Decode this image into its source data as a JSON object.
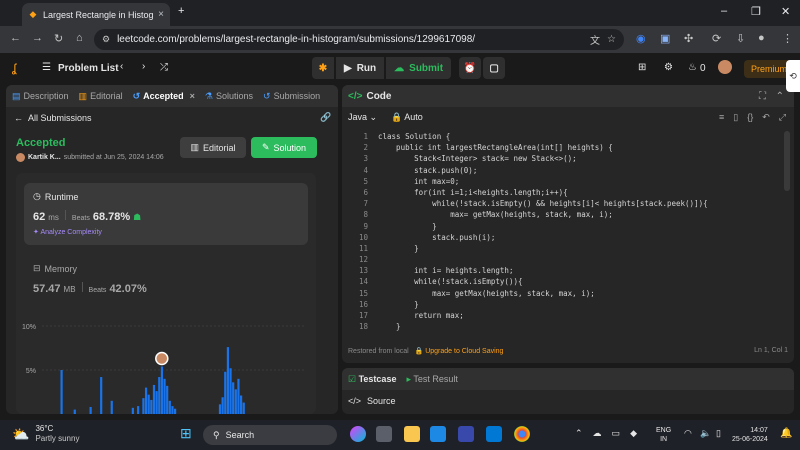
{
  "browser": {
    "tab_title": "Largest Rectangle in Histogram",
    "url": "leetcode.com/problems/largest-rectangle-in-histogram/submissions/1299617098/"
  },
  "nav": {
    "problem_list": "Problem List",
    "run": "Run",
    "submit": "Submit",
    "coins": "0",
    "premium": "Premium"
  },
  "left_tabs": [
    {
      "label": "Description",
      "icon": "doc-icon"
    },
    {
      "label": "Editorial",
      "icon": "book-icon"
    },
    {
      "label": "Accepted",
      "icon": "history-icon"
    },
    {
      "label": "Solutions",
      "icon": "flask-icon"
    },
    {
      "label": "Submission",
      "icon": "history-icon"
    }
  ],
  "submission": {
    "back_label": "All Submissions",
    "status": "Accepted",
    "user": "Kartik K...",
    "submitted_at": "submitted at Jun 25, 2024 14:06",
    "editorial_btn": "Editorial",
    "solution_btn": "Solution"
  },
  "runtime": {
    "title": "Runtime",
    "value": "62",
    "unit": "ms",
    "beats_label": "Beats",
    "beats": "68.78%",
    "analyze": "Analyze Complexity"
  },
  "memory": {
    "title": "Memory",
    "value": "57.47",
    "unit": "MB",
    "beats_label": "Beats",
    "beats": "42.07%"
  },
  "chart_data": {
    "type": "bar",
    "y_ticks": [
      "10%",
      "5%"
    ],
    "ylim": [
      0,
      10
    ],
    "bars": [
      {
        "pos": 0.07,
        "value": 5.0
      },
      {
        "pos": 0.12,
        "value": 0.5
      },
      {
        "pos": 0.18,
        "value": 0.8
      },
      {
        "pos": 0.22,
        "value": 4.2
      },
      {
        "pos": 0.26,
        "value": 1.5
      },
      {
        "pos": 0.34,
        "value": 0.7
      },
      {
        "pos": 0.36,
        "value": 0.9
      },
      {
        "pos": 0.38,
        "value": 1.8
      },
      {
        "pos": 0.39,
        "value": 3.0
      },
      {
        "pos": 0.4,
        "value": 2.2
      },
      {
        "pos": 0.41,
        "value": 1.6
      },
      {
        "pos": 0.42,
        "value": 3.3
      },
      {
        "pos": 0.43,
        "value": 2.6
      },
      {
        "pos": 0.44,
        "value": 4.2
      },
      {
        "pos": 0.45,
        "value": 5.4
      },
      {
        "pos": 0.46,
        "value": 4.0
      },
      {
        "pos": 0.47,
        "value": 3.2
      },
      {
        "pos": 0.48,
        "value": 1.5
      },
      {
        "pos": 0.49,
        "value": 0.9
      },
      {
        "pos": 0.5,
        "value": 0.6
      },
      {
        "pos": 0.67,
        "value": 1.1
      },
      {
        "pos": 0.68,
        "value": 1.9
      },
      {
        "pos": 0.69,
        "value": 4.8
      },
      {
        "pos": 0.7,
        "value": 7.6
      },
      {
        "pos": 0.71,
        "value": 5.2
      },
      {
        "pos": 0.72,
        "value": 3.6
      },
      {
        "pos": 0.73,
        "value": 2.8
      },
      {
        "pos": 0.74,
        "value": 4.0
      },
      {
        "pos": 0.75,
        "value": 2.1
      },
      {
        "pos": 0.76,
        "value": 1.3
      }
    ],
    "highlight_pos": 0.45
  },
  "code_panel": {
    "title": "Code",
    "language": "Java",
    "mode": "Auto",
    "line_numbers": [
      "1",
      "2",
      "3",
      "4",
      "5",
      "6",
      "7",
      "8",
      "9",
      "10",
      "11",
      "12",
      "13",
      "14",
      "15",
      "16",
      "17",
      "18"
    ],
    "lines": [
      "class Solution {",
      "    public int largestRectangleArea(int[] heights) {",
      "        Stack<Integer> stack= new Stack<>();",
      "        stack.push(0);",
      "        int max=0;",
      "        for(int i=1;i<heights.length;i++){",
      "            while(!stack.isEmpty() && heights[i]< heights[stack.peek()]){",
      "                max= getMax(heights, stack, max, i);",
      "            }",
      "            stack.push(i);",
      "        }",
      "",
      "        int i= heights.length;",
      "        while(!stack.isEmpty()){",
      "            max= getMax(heights, stack, max, i);",
      "        }",
      "        return max;",
      "    }"
    ],
    "restored": "Restored from local",
    "upgrade": "Upgrade to Cloud Saving",
    "cursor": "Ln 1, Col 1"
  },
  "test_panel": {
    "testcase": "Testcase",
    "result": "Test Result",
    "source": "Source"
  },
  "taskbar": {
    "temp": "36°C",
    "weather": "Partly sunny",
    "search": "Search",
    "lang1": "ENG",
    "lang2": "IN",
    "time": "14:07",
    "date": "25-06-2024"
  },
  "colors": {
    "accepted": "#2cbb5d",
    "accent": "#ffa116",
    "bar": "#1a73e8"
  }
}
